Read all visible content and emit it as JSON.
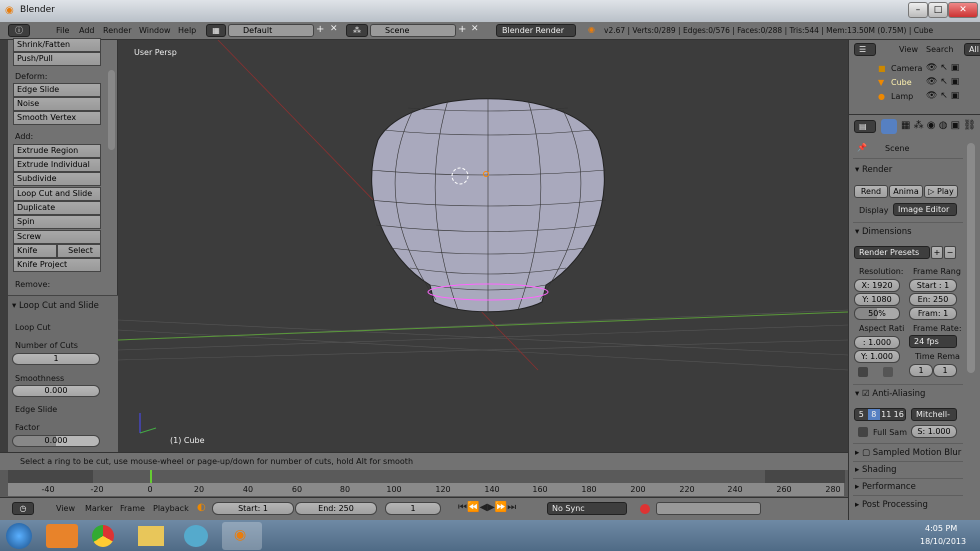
{
  "window": {
    "title": "Blender"
  },
  "header": {
    "menus": [
      "File",
      "Add",
      "Render",
      "Window",
      "Help"
    ],
    "layout": "Default",
    "scene": "Scene",
    "engine": "Blender Render",
    "stats": "v2.67 | Verts:0/289 | Edges:0/576 | Faces:0/288 | Tris:544 | Mem:13.50M (0.75M) | Cube"
  },
  "toolbar": {
    "top_buttons": [
      "Shrink/Fatten",
      "Push/Pull"
    ],
    "deform_label": "Deform:",
    "deform": [
      "Edge Slide",
      "Noise",
      "Smooth Vertex"
    ],
    "add_label": "Add:",
    "add": [
      "Extrude Region",
      "Extrude Individual",
      "Subdivide",
      "Loop Cut and Slide",
      "Duplicate",
      "Spin",
      "Screw"
    ],
    "knife": "Knife",
    "select": "Select",
    "knife_project": "Knife Project",
    "remove_label": "Remove:"
  },
  "operator": {
    "title": "Loop Cut and Slide",
    "loop_cut": "Loop Cut",
    "cuts_label": "Number of Cuts",
    "cuts": "1",
    "smooth_label": "Smoothness",
    "smooth": "0.000",
    "edge_slide": "Edge Slide",
    "factor_label": "Factor",
    "factor": "0.000"
  },
  "viewport": {
    "view_name": "User Persp",
    "object_label": "(1) Cube"
  },
  "outliner": {
    "view": "View",
    "search": "Search",
    "all": "All",
    "items": [
      "Camera",
      "Cube",
      "Lamp"
    ]
  },
  "properties": {
    "scene": "Scene",
    "render_section": "Render",
    "render_btn": "Rend",
    "anim_btn": "Anima",
    "play_btn": "Play",
    "display_label": "Display",
    "display_value": "Image Editor",
    "dimensions": "Dimensions",
    "presets": "Render Presets",
    "resolution_label": "Resolution:",
    "res_x": "X: 1920",
    "res_y": "Y: 1080",
    "res_pct": "50%",
    "frame_range_label": "Frame Rang",
    "start": "Start : 1",
    "end": "En: 250",
    "frame": "Fram: 1",
    "aspect_label": "Aspect Rati",
    "aspect_x": ": 1.000",
    "aspect_y": "Y: 1.000",
    "fps_label": "Frame Rate:",
    "fps": "24 fps",
    "time_remap_label": "Time Rema",
    "remap_old": "1",
    "remap_new": "1",
    "aa": "Anti-Aliasing",
    "aa_samples": [
      "5",
      "8",
      "11",
      "16"
    ],
    "aa_selected": "8",
    "filter": "Mitchell-",
    "full_sample": "Full Sam",
    "filter_size": "S: 1.000",
    "collapsed": [
      "Sampled Motion Blur",
      "Shading",
      "Performance",
      "Post Processing"
    ]
  },
  "status": {
    "text": "Select a ring to be cut, use mouse-wheel or page-up/down for number of cuts, hold Alt for smooth"
  },
  "timeline": {
    "ticks": [
      "-40",
      "-20",
      "0",
      "20",
      "40",
      "60",
      "80",
      "100",
      "120",
      "140",
      "160",
      "180",
      "200",
      "220",
      "240",
      "260",
      "280"
    ],
    "menus": [
      "View",
      "Marker",
      "Frame",
      "Playback"
    ],
    "start": "Start: 1",
    "end": "End: 250",
    "current": "1",
    "sync": "No Sync"
  },
  "taskbar": {
    "time": "4:05 PM",
    "date": "18/10/2013"
  },
  "colors": {
    "accent": "#5680c2",
    "mesh": "#b0b0c4",
    "selection": "#ff66ff"
  }
}
